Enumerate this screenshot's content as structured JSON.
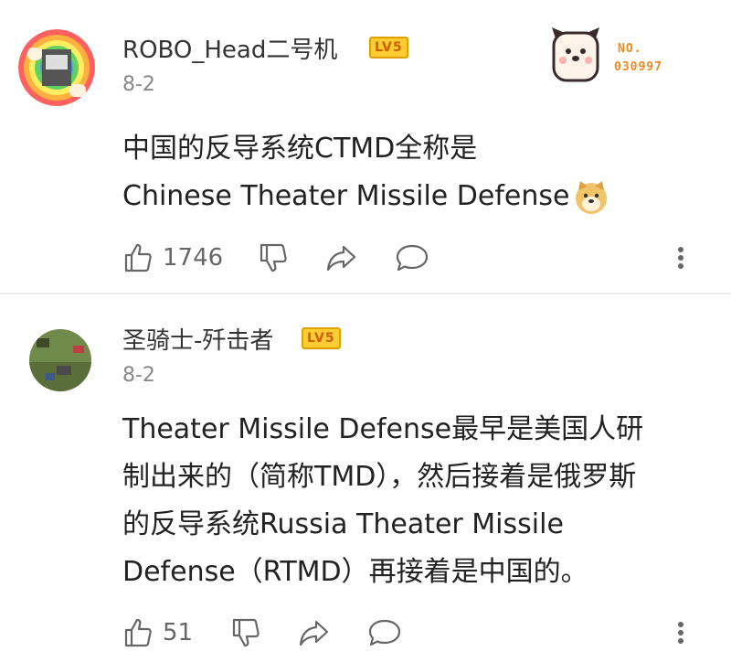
{
  "comments": [
    {
      "username": "ROBO_Head二号机",
      "level": "LV5",
      "date": "8-2",
      "text_line1": "中国的反导系统CTMD全称是",
      "text_line2": "Chinese Theater  Missile Defense",
      "likes": "1746",
      "stamp": {
        "no": "NO.",
        "number": "030997"
      }
    },
    {
      "username": "圣骑士-歼击者",
      "level": "LV5",
      "date": "8-2",
      "text_lines": [
        "Theater  Missile  Defense最早是美国人研",
        "制出来的（简称TMD），然后接着是俄罗斯",
        "的反导系统Russia  Theater  Missile",
        "Defense（RTMD）再接着是中国的。"
      ],
      "likes": "51"
    }
  ],
  "colors": {
    "accent": "#f08a20",
    "badge_bg": "#ffcc33",
    "icon": "#666666"
  }
}
